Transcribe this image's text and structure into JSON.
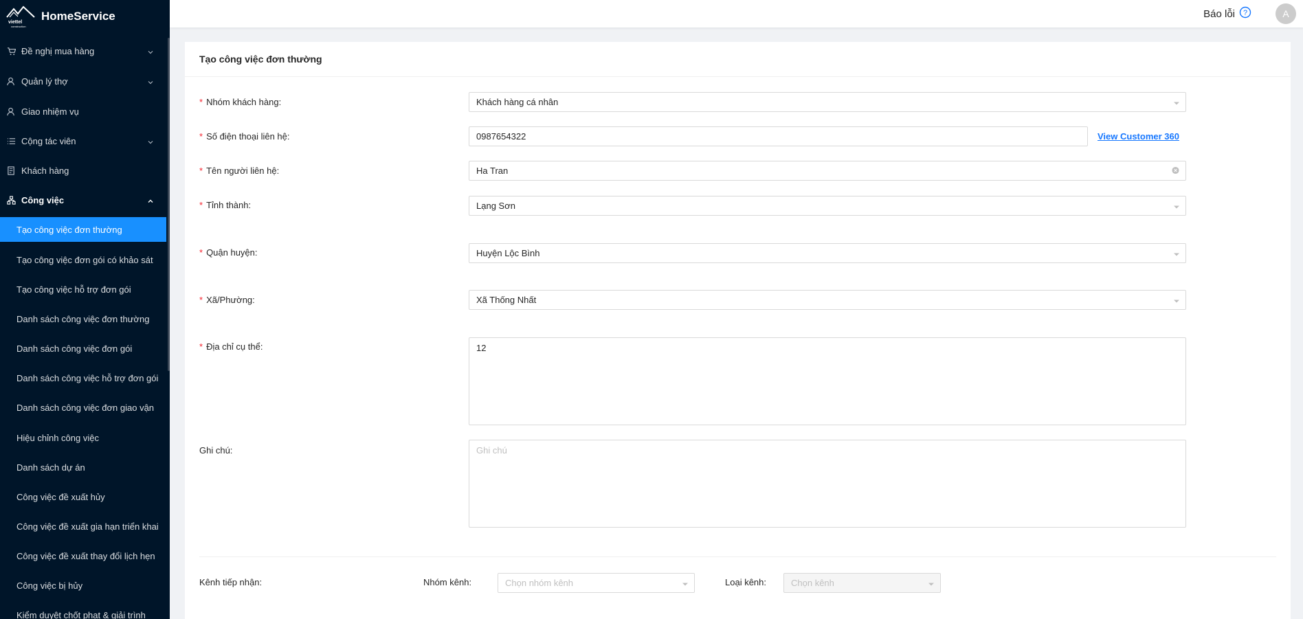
{
  "app": {
    "name": "HomeService",
    "logo_text": "viettel construction"
  },
  "sidebar": {
    "menus": [
      {
        "label": "Đề nghị mua hàng",
        "icon": "cart-icon",
        "has_arrow": true
      },
      {
        "label": "Quản lý thợ",
        "icon": "user-icon",
        "has_arrow": true
      },
      {
        "label": "Giao nhiệm vụ",
        "icon": "user-icon",
        "has_arrow": false
      },
      {
        "label": "Cộng tác viên",
        "icon": "list-icon",
        "has_arrow": true
      },
      {
        "label": "Khách hàng",
        "icon": "document-icon",
        "has_arrow": false
      },
      {
        "label": "Công việc",
        "icon": "cluster-icon",
        "has_arrow": true,
        "open": true
      }
    ],
    "sub_items": [
      "Tạo công việc đơn thường",
      "Tạo công việc đơn gói có khảo sát",
      "Tạo công việc hỗ trợ đơn gói",
      "Danh sách công việc đơn thường",
      "Danh sách công việc đơn gói",
      "Danh sách công việc hỗ trợ đơn gói",
      "Danh sách công việc đơn giao vận",
      "Hiệu chỉnh công việc",
      "Danh sách dự án",
      "Công việc đề xuất hủy",
      "Công việc đề xuất gia hạn triển khai",
      "Công việc đề xuất thay đổi lịch hẹn",
      "Công việc bị hủy",
      "Kiểm duyệt chốt phạt & giải trình"
    ],
    "active_sub_index": 0
  },
  "header": {
    "report_label": "Báo lỗi",
    "avatar_initial": "A"
  },
  "form": {
    "title": "Tạo công việc đơn thường",
    "customer_group": {
      "label": "Nhóm khách hàng:",
      "value": "Khách hàng cá nhân"
    },
    "phone": {
      "label": "Số điện thoại liên hệ:",
      "value": "0987654322",
      "link": "View Customer 360"
    },
    "contact_name": {
      "label": "Tên người liên hệ:",
      "value": "Ha Tran"
    },
    "province": {
      "label": "Tỉnh thành:",
      "value": "Lạng Sơn"
    },
    "district": {
      "label": "Quận huyện:",
      "value": "Huyện Lộc Bình"
    },
    "ward": {
      "label": "Xã/Phường:",
      "value": "Xã Thống Nhất"
    },
    "address": {
      "label": "Địa chỉ cụ thể:",
      "value": "12"
    },
    "note": {
      "label": "Ghi chú:",
      "placeholder": "Ghi chú"
    },
    "channel": {
      "label": "Kênh tiếp nhận:",
      "group_label": "Nhóm kênh:",
      "group_placeholder": "Chọn nhóm kênh",
      "type_label": "Loại kênh:",
      "type_placeholder": "Chọn kênh"
    }
  },
  "colors": {
    "sidebar_bg": "#001529",
    "active_bg": "#1890ff",
    "required": "#f5222d",
    "link": "#1677ff"
  }
}
